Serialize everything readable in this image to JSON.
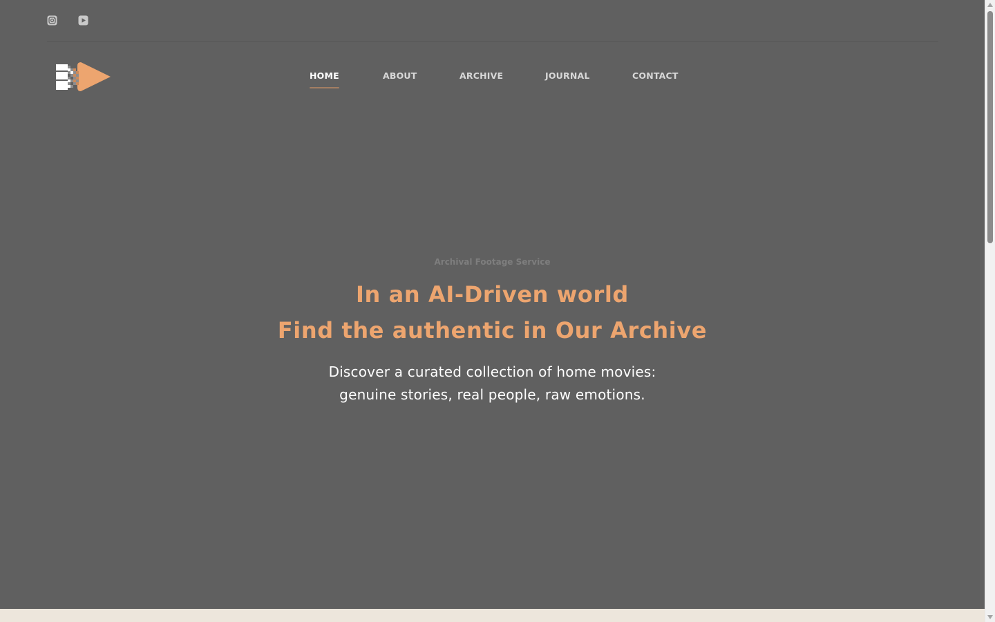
{
  "social": [
    {
      "icon": "instagram-icon"
    },
    {
      "icon": "youtube-icon"
    }
  ],
  "nav": {
    "items": [
      {
        "label": "HOME",
        "active": true
      },
      {
        "label": "ABOUT",
        "active": false
      },
      {
        "label": "ARCHIVE",
        "active": false
      },
      {
        "label": "JOURNAL",
        "active": false
      },
      {
        "label": "CONTACT",
        "active": false
      }
    ]
  },
  "hero": {
    "eyebrow": "Archival Footage Service",
    "headline_line1": "In an AI-Driven world",
    "headline_line2": "Find the authentic in Our Archive",
    "subtitle_line1": "Discover a curated collection of home movies:",
    "subtitle_line2": "genuine stories, real people, raw emotions."
  },
  "colors": {
    "hero_bg": "#606060",
    "accent": "#eda56f",
    "nav_underline": "#a47f63",
    "page_bg": "#ede6dc"
  }
}
